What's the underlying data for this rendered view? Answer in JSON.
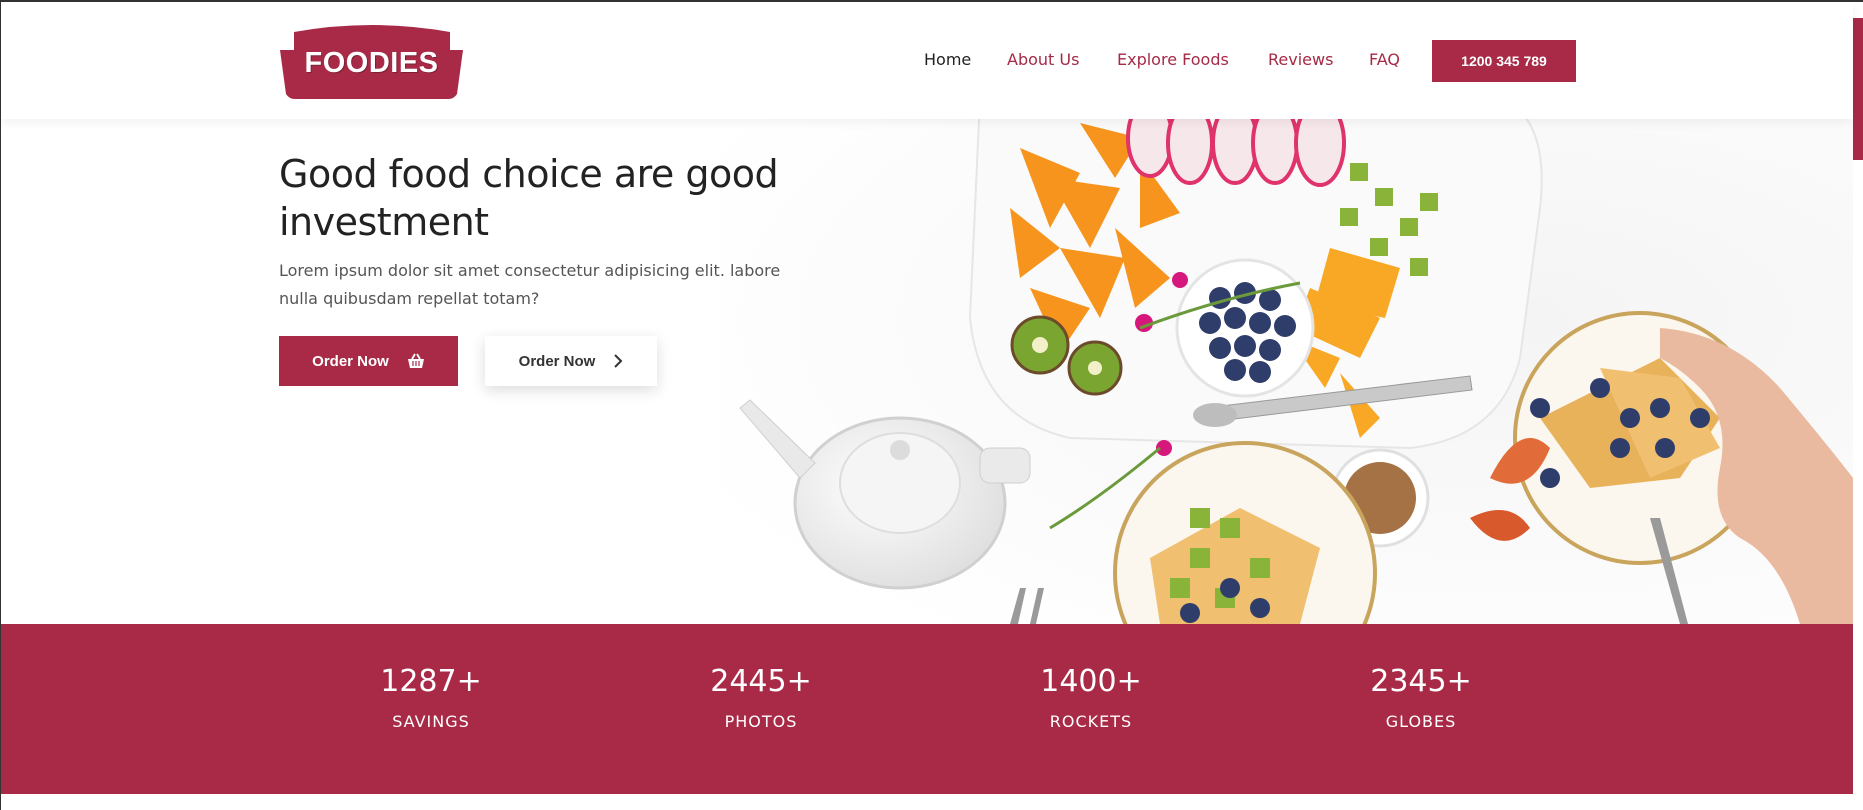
{
  "brand": {
    "name": "FOODIES",
    "color": "#a82a47"
  },
  "nav": {
    "items": [
      {
        "label": "Home",
        "active": true
      },
      {
        "label": "About Us",
        "active": false
      },
      {
        "label": "Explore Foods",
        "active": false
      },
      {
        "label": "Reviews",
        "active": false
      },
      {
        "label": "FAQ",
        "active": false
      }
    ],
    "phone": "1200 345 789"
  },
  "hero": {
    "title": "Good food choice are good investment",
    "text": "Lorem ipsum dolor sit amet consectetur adipisicing elit. labore nulla quibusdam repellat totam?",
    "primary_button": {
      "label": "Order Now",
      "icon": "basket-icon"
    },
    "secondary_button": {
      "label": "Order Now",
      "icon": "chevron-right-icon"
    }
  },
  "stats": [
    {
      "value": "1287+",
      "label": "SAVINGS"
    },
    {
      "value": "2445+",
      "label": "PHOTOS"
    },
    {
      "value": "1400+",
      "label": "ROCKETS"
    },
    {
      "value": "2345+",
      "label": "GLOBES"
    }
  ]
}
